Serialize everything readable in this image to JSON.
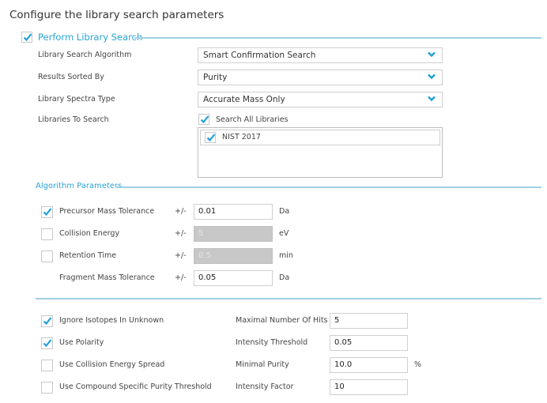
{
  "title": "Configure the library search parameters",
  "accent_color": "#2aa4d6",
  "perform_search": {
    "label": "Perform Library Search",
    "checked": true
  },
  "fields": [
    {
      "label": "Library Search Algorithm",
      "value": "Smart Confirmation Search",
      "icon": "chevron-down-icon"
    },
    {
      "label": "Results Sorted By",
      "value": "Purity",
      "icon": "chevron-down-icon"
    },
    {
      "label": "Library Spectra Type",
      "value": "Accurate Mass Only",
      "icon": "chevron-down-icon"
    }
  ],
  "libraries": {
    "label": "Libraries To Search",
    "search_all": {
      "label": "Search All Libraries",
      "checked": true
    },
    "items": [
      {
        "label": "NIST 2017",
        "checked": true
      }
    ]
  },
  "algorithm": {
    "title": "Algorithm Parameters",
    "rows": [
      {
        "label": "Precursor Mass Tolerance",
        "pm": "+/-",
        "value": "0.01",
        "unit": "Da",
        "checked": true,
        "has_checkbox": true,
        "enabled": true
      },
      {
        "label": "Collision Energy",
        "pm": "+/-",
        "value": "5",
        "unit": "eV",
        "checked": false,
        "has_checkbox": true,
        "enabled": false
      },
      {
        "label": "Retention Time",
        "pm": "+/-",
        "value": "0.5",
        "unit": "min",
        "checked": false,
        "has_checkbox": true,
        "enabled": false
      },
      {
        "label": "Fragment Mass Tolerance",
        "pm": "+/-",
        "value": "0.05",
        "unit": "Da",
        "has_checkbox": false,
        "enabled": true
      }
    ]
  },
  "options": [
    {
      "label": "Ignore Isotopes In Unknown",
      "checked": true
    },
    {
      "label": "Use Polarity",
      "checked": true
    },
    {
      "label": "Use Collision Energy Spread",
      "checked": false
    },
    {
      "label": "Use Compound Specific Purity Threshold",
      "checked": false
    }
  ],
  "params": [
    {
      "label": "Maximal Number Of Hits",
      "value": "5",
      "unit": ""
    },
    {
      "label": "Intensity Threshold",
      "value": "0.05",
      "unit": ""
    },
    {
      "label": "Minimal Purity",
      "value": "10.0",
      "unit": "%"
    },
    {
      "label": "Intensity Factor",
      "value": "10",
      "unit": ""
    }
  ]
}
